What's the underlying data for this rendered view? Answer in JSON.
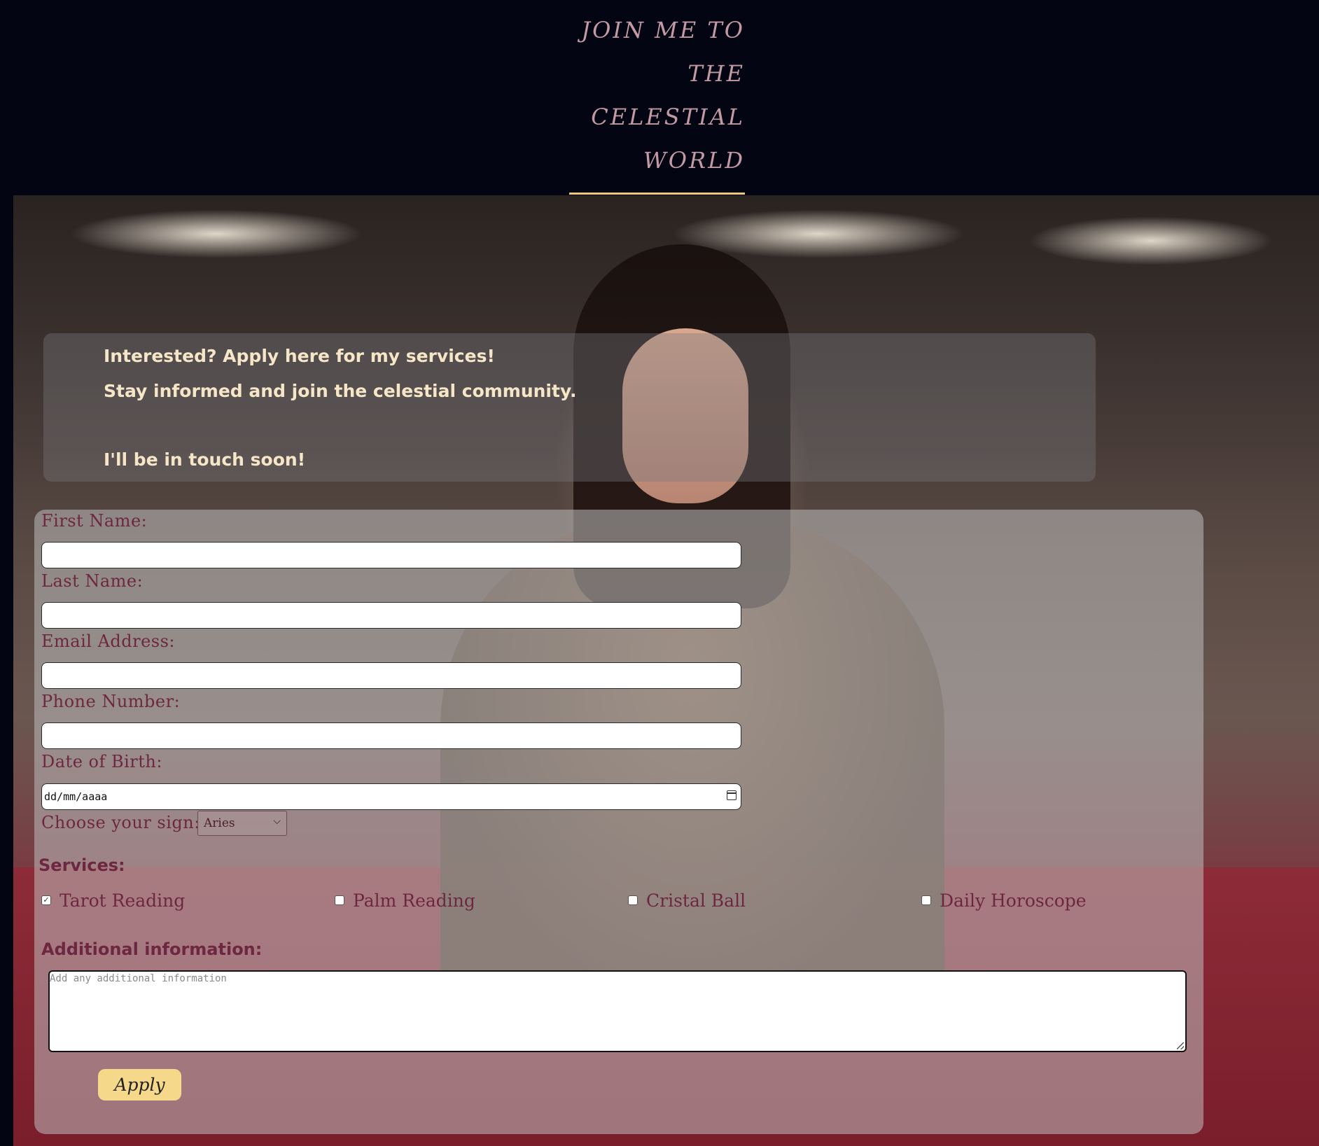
{
  "header": {
    "title_lines": [
      "JOIN ME TO",
      "THE",
      "CELESTIAL",
      "WORLD"
    ]
  },
  "colors": {
    "header_bg": "#030512",
    "title": "#c39aa4",
    "underline": "#e8c87a",
    "intro_text": "#f6e6c8",
    "label": "#6e2740",
    "apply_button": "#f6d88a"
  },
  "intro": {
    "line1": "Interested? Apply here for my services!",
    "line2": "Stay informed and join the celestial community.",
    "line3": "I'll be in touch soon!"
  },
  "form": {
    "first_name_label": "First Name:",
    "last_name_label": "Last Name:",
    "email_label": "Email Address:",
    "phone_label": "Phone Number:",
    "dob_label": "Date of Birth:",
    "dob_placeholder": "dd/mm/aaaa",
    "sign_label": "Choose your sign:",
    "sign_selected": "Aries",
    "services_title": "Services:",
    "services": [
      {
        "label": "Tarot Reading",
        "checked": true
      },
      {
        "label": "Palm Reading",
        "checked": false
      },
      {
        "label": "Cristal Ball",
        "checked": false
      },
      {
        "label": "Daily Horoscope",
        "checked": false
      }
    ],
    "additional_label": "Additional information:",
    "additional_placeholder": "Add any additional information",
    "apply_label": "Apply"
  },
  "icons": {
    "calendar": "calendar-icon",
    "chevron": "chevron-down-icon",
    "check": "checkmark-icon",
    "resize": "resize-handle-icon"
  }
}
